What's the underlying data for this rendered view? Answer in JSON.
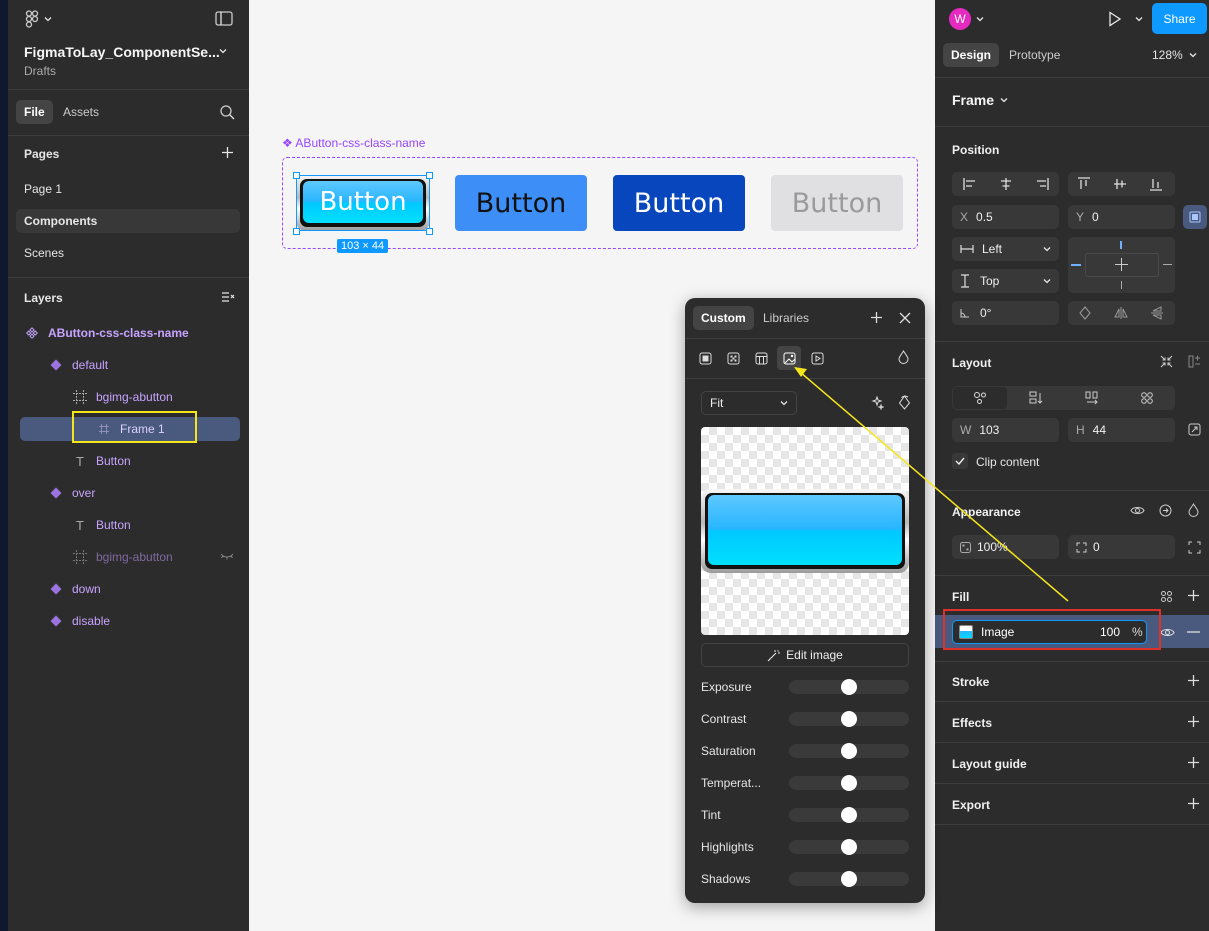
{
  "left": {
    "file_name": "FigmaToLay_ComponentSe...",
    "location": "Drafts",
    "tabs": [
      "File",
      "Assets"
    ],
    "pages_header": "Pages",
    "pages": [
      "Page 1",
      "Components",
      "Scenes"
    ],
    "layers_header": "Layers",
    "layers": {
      "root": "AButton-css-class-name",
      "default": "default",
      "bgimg1": "bgimg-abutton",
      "frame1": "Frame 1",
      "button1": "Button",
      "over": "over",
      "button2": "Button",
      "bgimg2": "bgimg-abutton",
      "down": "down",
      "disable": "disable"
    }
  },
  "canvas": {
    "component_label": "❖ AButton-css-class-name",
    "dimension_badge": "103 × 44",
    "buttons": [
      {
        "label": "Button",
        "state": "default-image"
      },
      {
        "label": "Button",
        "bg": "#3d8ef6"
      },
      {
        "label": "Button",
        "bg": "#0746bd"
      },
      {
        "label": "Button",
        "bg": "#e0e0e3"
      }
    ]
  },
  "popup": {
    "tabs": [
      "Custom",
      "Libraries"
    ],
    "fill_types": [
      "solid-icon",
      "gradient-icon",
      "pattern-icon",
      "image-icon",
      "video-icon"
    ],
    "fit_label": "Fit",
    "edit_image": "Edit image",
    "adjustments": [
      {
        "label": "Exposure",
        "value": 0.5
      },
      {
        "label": "Contrast",
        "value": 0.5
      },
      {
        "label": "Saturation",
        "value": 0.5
      },
      {
        "label": "Temperat...",
        "value": 0.5
      },
      {
        "label": "Tint",
        "value": 0.5
      },
      {
        "label": "Highlights",
        "value": 0.5
      },
      {
        "label": "Shadows",
        "value": 0.5
      }
    ]
  },
  "right": {
    "avatar": "W",
    "share": "Share",
    "tabs": [
      "Design",
      "Prototype"
    ],
    "zoom": "128%",
    "frame": "Frame",
    "position": {
      "header": "Position",
      "x_label": "X",
      "x": "0.5",
      "y_label": "Y",
      "y": "0",
      "h_constraint": "Left",
      "v_constraint": "Top",
      "rotation": "0°"
    },
    "layout": {
      "header": "Layout",
      "w_label": "W",
      "w": "103",
      "h_label": "H",
      "h": "44",
      "clip_content": "Clip content"
    },
    "appearance": {
      "header": "Appearance",
      "opacity": "100%",
      "radius": "0"
    },
    "fill": {
      "header": "Fill",
      "type": "Image",
      "opacity": "100",
      "unit": "%"
    },
    "sections": [
      "Stroke",
      "Effects",
      "Layout guide",
      "Export"
    ]
  }
}
